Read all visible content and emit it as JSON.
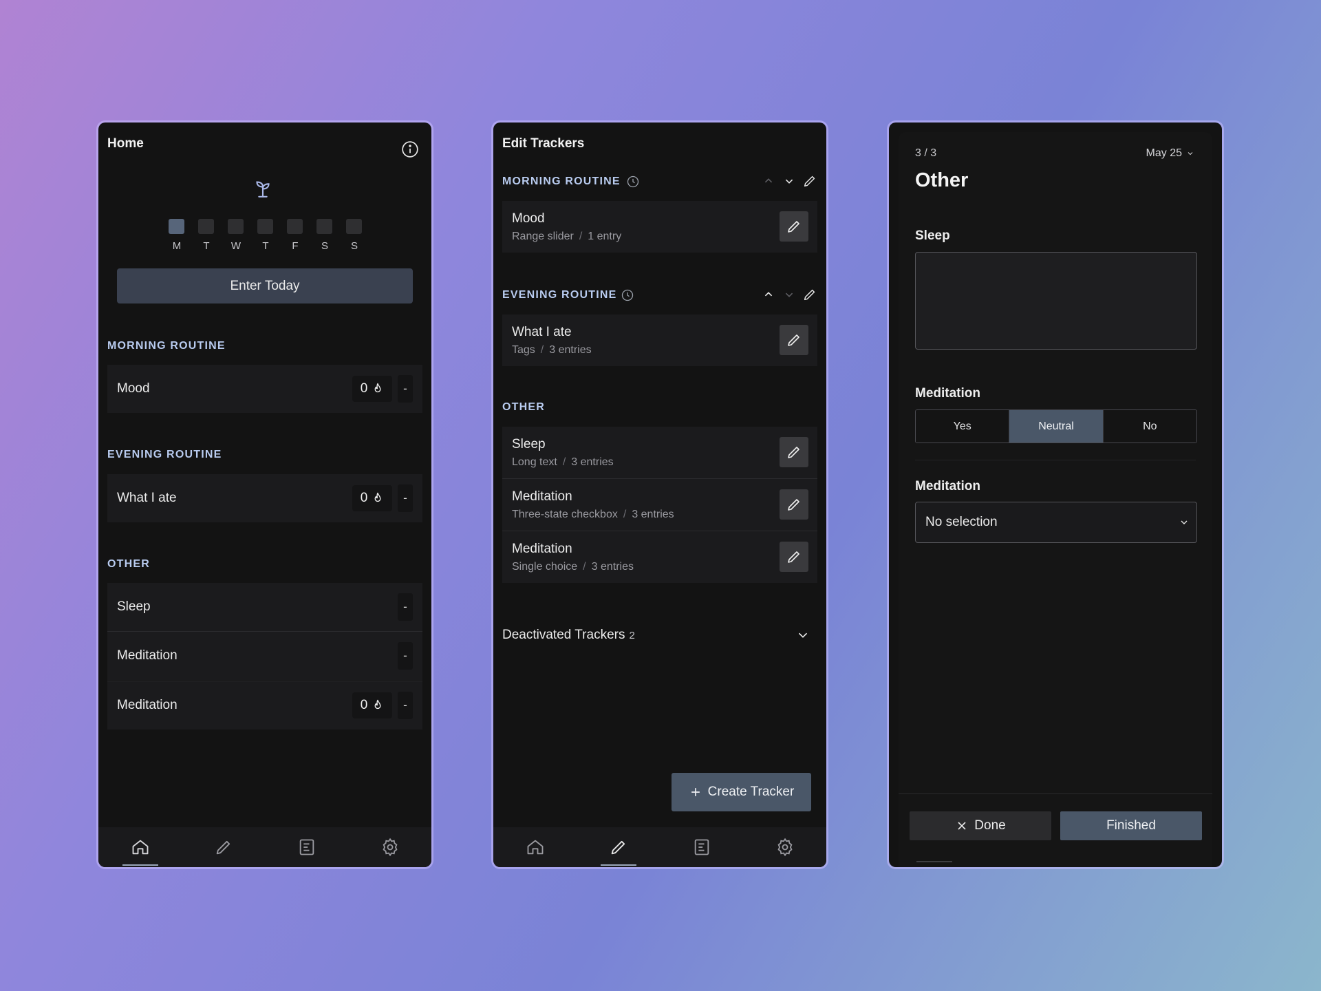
{
  "home": {
    "title": "Home",
    "week_days": [
      "M",
      "T",
      "W",
      "T",
      "F",
      "S",
      "S"
    ],
    "active_day_index": 0,
    "enter_button": "Enter Today",
    "sections": [
      {
        "label": "MORNING ROUTINE",
        "items": [
          {
            "name": "Mood",
            "streak": "0",
            "value": "-"
          }
        ]
      },
      {
        "label": "EVENING ROUTINE",
        "items": [
          {
            "name": "What I ate",
            "streak": "0",
            "value": "-"
          }
        ]
      },
      {
        "label": "OTHER",
        "items": [
          {
            "name": "Sleep",
            "value": "-"
          },
          {
            "name": "Meditation",
            "value": "-"
          },
          {
            "name": "Meditation",
            "streak": "0",
            "value": "-"
          }
        ]
      }
    ],
    "nav_active": "home"
  },
  "edit": {
    "title": "Edit Trackers",
    "sections": [
      {
        "label": "MORNING ROUTINE",
        "items": [
          {
            "name": "Mood",
            "type": "Range slider",
            "count": "1 entry"
          }
        ]
      },
      {
        "label": "EVENING ROUTINE",
        "items": [
          {
            "name": "What I ate",
            "type": "Tags",
            "count": "3 entries"
          }
        ]
      },
      {
        "label": "OTHER",
        "items": [
          {
            "name": "Sleep",
            "type": "Long text",
            "count": "3 entries"
          },
          {
            "name": "Meditation",
            "type": "Three-state checkbox",
            "count": "3 entries"
          },
          {
            "name": "Meditation",
            "type": "Single choice",
            "count": "3 entries"
          }
        ]
      }
    ],
    "deactivated_label": "Deactivated Trackers",
    "deactivated_count": "2",
    "create_button": "Create Tracker",
    "separator": "/",
    "nav_active": "edit"
  },
  "other": {
    "counter": "3 / 3",
    "date": "May 25",
    "title": "Other",
    "sleep_label": "Sleep",
    "meditation_label_1": "Meditation",
    "tri_options": [
      "Yes",
      "Neutral",
      "No"
    ],
    "tri_selected": "Neutral",
    "meditation_label_2": "Meditation",
    "select_value": "No selection",
    "done_button": "Done",
    "finished_button": "Finished"
  },
  "colors": {
    "accent": "#4a5768",
    "section_label": "#b9ccf0",
    "panel_bg": "#131313"
  },
  "icons": [
    "info-icon",
    "sprout-icon",
    "flame-icon",
    "home-icon",
    "pencil-icon",
    "journal-icon",
    "gear-icon",
    "clock-icon",
    "chevron-up-icon",
    "chevron-down-icon",
    "plus-icon",
    "close-icon"
  ]
}
